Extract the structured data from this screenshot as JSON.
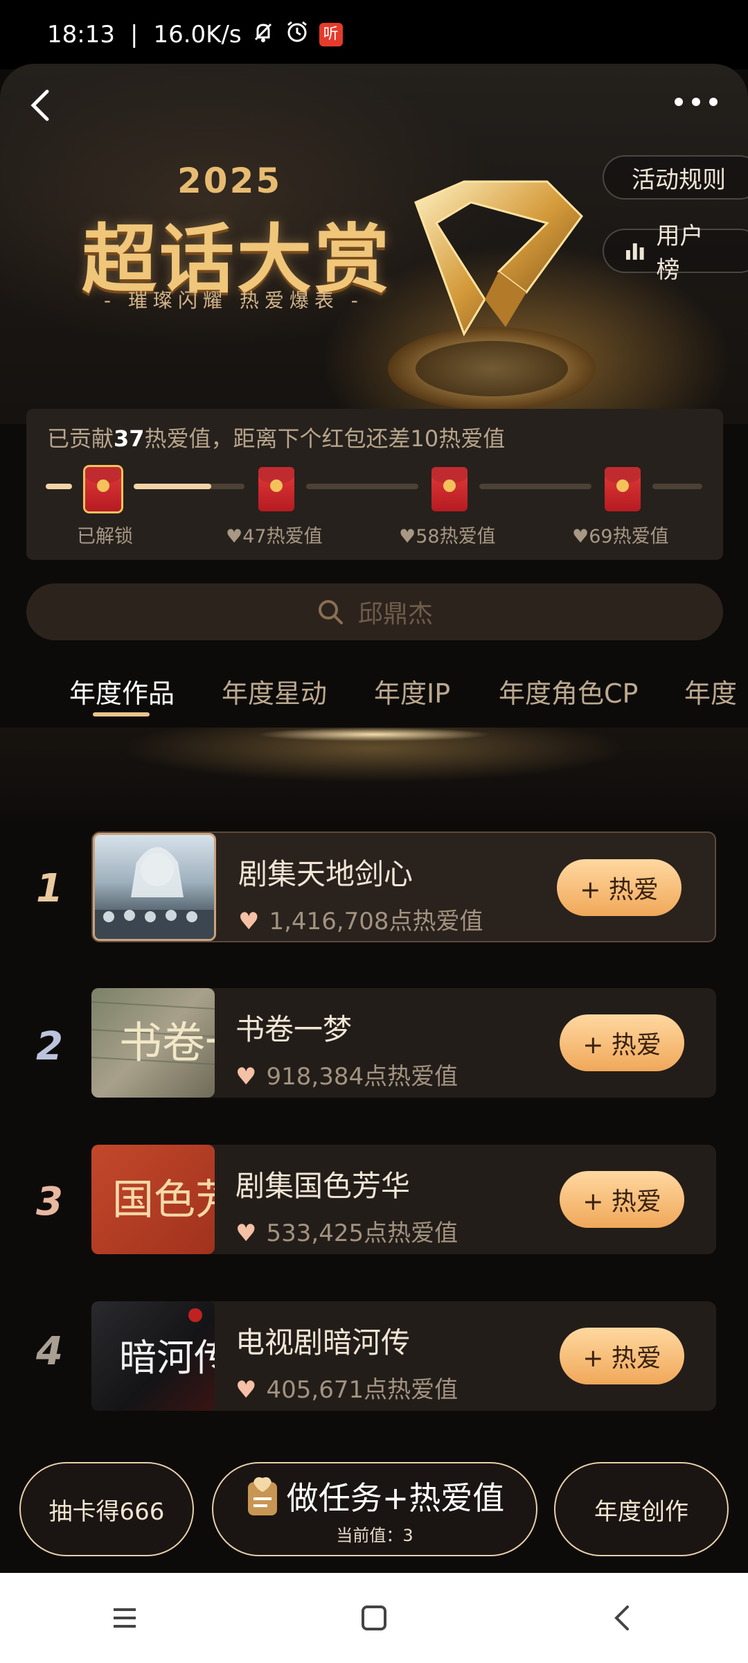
{
  "status_bar": {
    "time": "18:13",
    "speed": "16.0K/s",
    "icons": [
      "bell-mute-icon",
      "alarm-icon",
      "ting-app-icon"
    ],
    "ting_label": "听"
  },
  "hero": {
    "year": "2025",
    "title": "超话大赏",
    "subtitle": "- 璀璨闪耀 热爱爆表 -",
    "rules_button": "活动规则",
    "users_button": "用户榜"
  },
  "progress": {
    "contributed_prefix": "已贡献",
    "contributed_value": "37",
    "contributed_suffix": "热爱值，距离下个红包还差10热爱值",
    "milestones": [
      {
        "label": "已解锁",
        "unlocked": true
      },
      {
        "label": "47热爱值",
        "unlocked": false
      },
      {
        "label": "58热爱值",
        "unlocked": false
      },
      {
        "label": "69热爱值",
        "unlocked": false
      }
    ],
    "current_fill": 0.7
  },
  "search": {
    "placeholder": "邱鼎杰"
  },
  "tabs": [
    "年度作品",
    "年度星动",
    "年度IP",
    "年度角色CP",
    "年度"
  ],
  "ranking": [
    {
      "rank": "1",
      "title": "剧集天地剑心",
      "value": "1,416,708点热爱值",
      "button": "+ 热爱",
      "rank_color": "#e8c9a0"
    },
    {
      "rank": "2",
      "title": "书卷一梦",
      "value": "918,384点热爱值",
      "button": "+ 热爱",
      "rank_color": "#bcc4dc"
    },
    {
      "rank": "3",
      "title": "剧集国色芳华",
      "value": "533,425点热爱值",
      "button": "+ 热爱",
      "rank_color": "#e8b8a0"
    },
    {
      "rank": "4",
      "title": "电视剧暗河传",
      "value": "405,671点热爱值",
      "button": "+ 热爱",
      "rank_color": "#a99f93"
    }
  ],
  "thumb_text": {
    "t2": "书卷一梦",
    "t3": "国色芳华",
    "t4": "暗河传"
  },
  "bottom": {
    "left": "抽卡得666",
    "mid_title": "做任务+热爱值",
    "mid_sub": "当前值：3",
    "right": "年度创作"
  }
}
